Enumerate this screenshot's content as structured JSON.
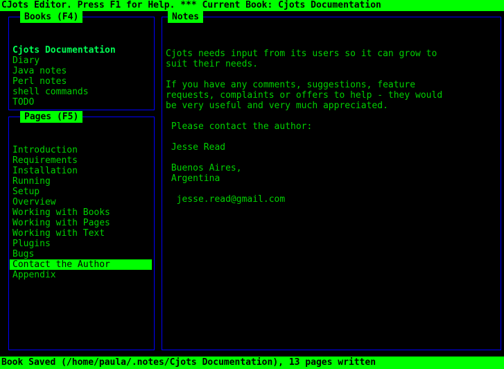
{
  "titlebar": {
    "text": "CJots Editor. Press F1 for Help. *** Current Book: Cjots Documentation"
  },
  "statusbar": {
    "text": "Book Saved (/home/paula/.notes/Cjots Documentation), 13 pages written"
  },
  "books_panel": {
    "title": "Books (F4)",
    "items": [
      {
        "label": "Cjots Documentation",
        "current": true,
        "selected": false
      },
      {
        "label": "Diary",
        "current": false,
        "selected": false
      },
      {
        "label": "Java notes",
        "current": false,
        "selected": false
      },
      {
        "label": "Perl notes",
        "current": false,
        "selected": false
      },
      {
        "label": "shell commands",
        "current": false,
        "selected": false
      },
      {
        "label": "TODO",
        "current": false,
        "selected": false
      }
    ]
  },
  "pages_panel": {
    "title": "Pages (F5)",
    "items": [
      {
        "label": "Introduction",
        "selected": false
      },
      {
        "label": "Requirements",
        "selected": false
      },
      {
        "label": "Installation",
        "selected": false
      },
      {
        "label": "Running",
        "selected": false
      },
      {
        "label": "Setup",
        "selected": false
      },
      {
        "label": "Overview",
        "selected": false
      },
      {
        "label": "Working with Books",
        "selected": false
      },
      {
        "label": "Working with Pages",
        "selected": false
      },
      {
        "label": "Working with Text",
        "selected": false
      },
      {
        "label": "Plugins",
        "selected": false
      },
      {
        "label": "Bugs",
        "selected": false
      },
      {
        "label": "Contact the Author",
        "selected": true
      },
      {
        "label": "Appendix",
        "selected": false
      }
    ]
  },
  "notes_panel": {
    "title": "Notes",
    "lines": [
      "Cjots needs input from its users so it can grow to",
      "suit their needs.",
      "",
      "If you have any comments, suggestions, feature",
      "requests, complaints or offers to help - they would",
      "be very useful and very much appreciated.",
      "",
      " Please contact the author:",
      "",
      " Jesse Read",
      "",
      " Buenos Aires,",
      " Argentina",
      "",
      "  jesse.read@gmail.com"
    ]
  },
  "colors": {
    "background": "#000000",
    "text_green": "#00d000",
    "bright_green": "#00ff00",
    "border_blue": "#0000ff",
    "highlight_fg": "#000000"
  }
}
